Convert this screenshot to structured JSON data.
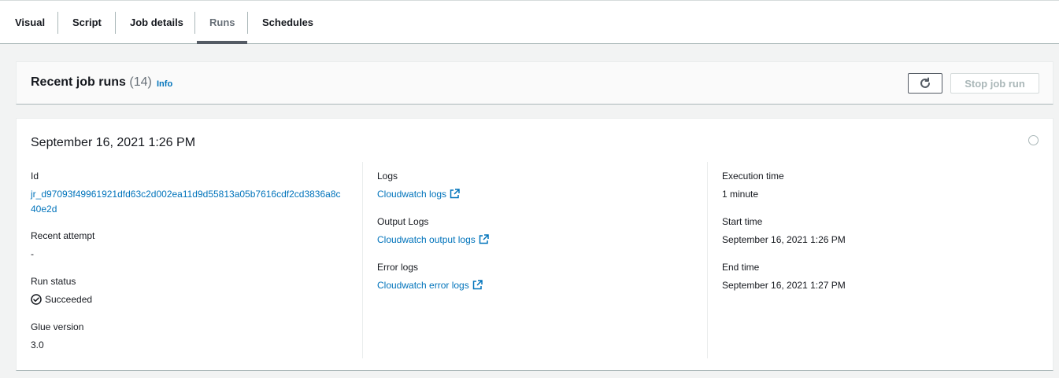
{
  "tabs": [
    {
      "label": "Visual"
    },
    {
      "label": "Script"
    },
    {
      "label": "Job details"
    },
    {
      "label": "Runs"
    },
    {
      "label": "Schedules"
    }
  ],
  "active_tab": "Runs",
  "header": {
    "title": "Recent job runs",
    "count": "(14)",
    "info_label": "Info",
    "stop_label": "Stop job run"
  },
  "run": {
    "title": "September 16, 2021 1:26 PM",
    "id_label": "Id",
    "id_value": "jr_d97093f49961921dfd63c2d002ea11d9d55813a05b7616cdf2cd3836a8c40e2d",
    "attempt_label": "Recent attempt",
    "attempt_value": "-",
    "status_label": "Run status",
    "status_value": "Succeeded",
    "glue_label": "Glue version",
    "glue_value": "3.0",
    "logs_label": "Logs",
    "logs_link": "Cloudwatch logs",
    "output_logs_label": "Output Logs",
    "output_logs_link": "Cloudwatch output logs",
    "error_logs_label": "Error logs",
    "error_logs_link": "Cloudwatch error logs",
    "exec_label": "Execution time",
    "exec_value": "1 minute",
    "start_label": "Start time",
    "start_value": "September 16, 2021 1:26 PM",
    "end_label": "End time",
    "end_value": "September 16, 2021 1:27 PM"
  },
  "colors": {
    "link": "#0073bb",
    "success": "#1d8102",
    "text": "#16191f",
    "muted": "#687078"
  },
  "icons": {
    "refresh": "refresh-icon",
    "external": "external-link-icon",
    "status": "check-circle-icon"
  }
}
